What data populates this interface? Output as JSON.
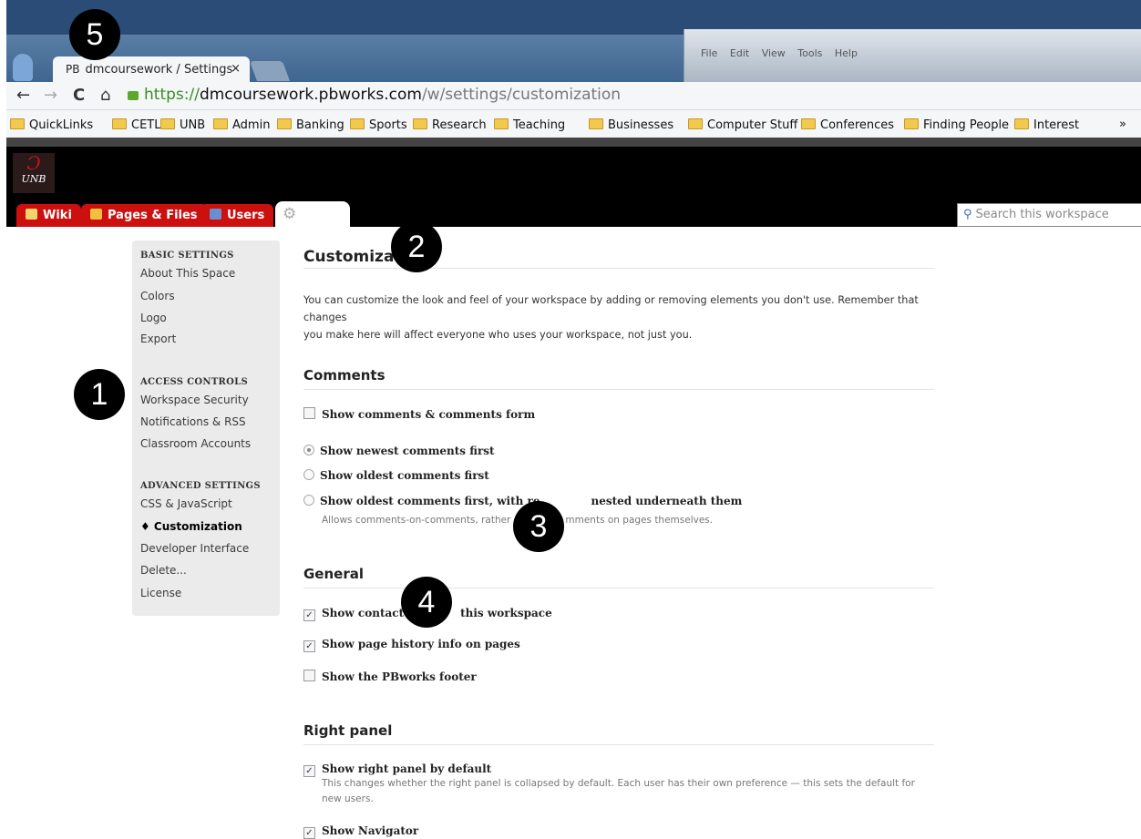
{
  "browser": {
    "tab_title": "dmcoursework / Settings",
    "tab_prefix": "PB",
    "close_glyph": "×",
    "url_scheme": "https://",
    "url_host": "dmcoursework.pbworks.com",
    "url_path": "/w/settings/customization",
    "bookmarks": [
      "QuickLinks",
      "CETL",
      "UNB",
      "Admin",
      "Banking",
      "Sports",
      "Research",
      "Teaching",
      "Businesses",
      "Computer Stuff",
      "Conferences",
      "Finding People",
      "Interest"
    ],
    "bookmarks_more": "»",
    "bg_window_menu": "File Edit View Tools Help"
  },
  "header": {
    "logo_text": "UNB",
    "tabs": [
      "Wiki",
      "Pages & Files",
      "Users"
    ],
    "search_placeholder": "Search this workspace"
  },
  "sidebar": {
    "basic_heading": "BASIC SETTINGS",
    "basic_items": [
      "About This Space",
      "Colors",
      "Logo",
      "Export"
    ],
    "access_heading": "ACCESS CONTROLS",
    "access_items": [
      "Workspace Security",
      "Notifications & RSS",
      "Classroom Accounts"
    ],
    "advanced_heading": "ADVANCED SETTINGS",
    "advanced_items": [
      "CSS & JavaScript",
      "♦ Customization",
      "Developer Interface",
      "Delete...",
      "License"
    ]
  },
  "main": {
    "title": "Customizat",
    "intro_1": "You can customize the look and feel of your workspace by adding or removing elements you don't use. Remember that changes",
    "intro_2": "you make here will affect everyone who uses your workspace, not just you.",
    "comments_heading": "Comments",
    "show_comments": "Show comments & comments form",
    "radio_newest": "Show newest comments first",
    "radio_oldest": "Show oldest comments first",
    "radio_nested_a": "Show oldest comments first, with re",
    "radio_nested_b": "nested underneath them",
    "nested_help_a": "Allows comments-on-comments, rather",
    "nested_help_b": "mments on pages themselves.",
    "general_heading": "General",
    "show_contact_a": "Show contact",
    "show_contact_b": "this workspace",
    "show_history": "Show page history info on pages",
    "show_footer": "Show the PBworks footer",
    "right_panel_heading": "Right panel",
    "show_right_panel": "Show right panel by default",
    "right_panel_help_1": "This changes whether the right panel is collapsed by default. Each user has their own preference — this sets the default for",
    "right_panel_help_2": "new users.",
    "show_navigator": "Show Navigator",
    "checked_glyph": "✓"
  },
  "annotations": [
    "5",
    "2",
    "1",
    "3",
    "4"
  ]
}
